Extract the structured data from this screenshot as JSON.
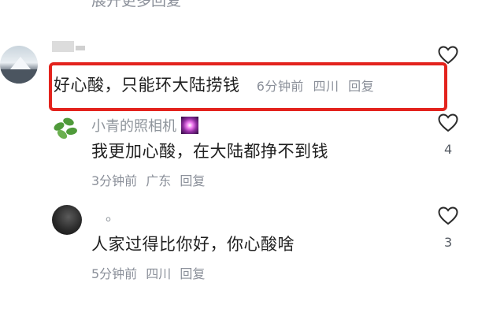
{
  "top_clipped_text": "展开更多回复",
  "comments": [
    {
      "username": "",
      "text": "好心酸，只能环大陆捞钱",
      "time": "6分钟前",
      "location": "四川",
      "reply_label": "回复",
      "likes": ""
    },
    {
      "username": "小青的照相机",
      "text": "我更加心酸，在大陆都挣不到钱",
      "time": "3分钟前",
      "location": "广东",
      "reply_label": "回复",
      "likes": "4"
    },
    {
      "username": "。",
      "text": "人家过得比你好，你心酸啥",
      "time": "5分钟前",
      "location": "四川",
      "reply_label": "回复",
      "likes": "3"
    }
  ],
  "colors": {
    "highlight_border": "#e3231d",
    "meta_text": "#8a8f99",
    "body_text": "#1f1f1f"
  },
  "icons": [
    "heart-outline-icon",
    "sparkle-emoji-icon"
  ]
}
